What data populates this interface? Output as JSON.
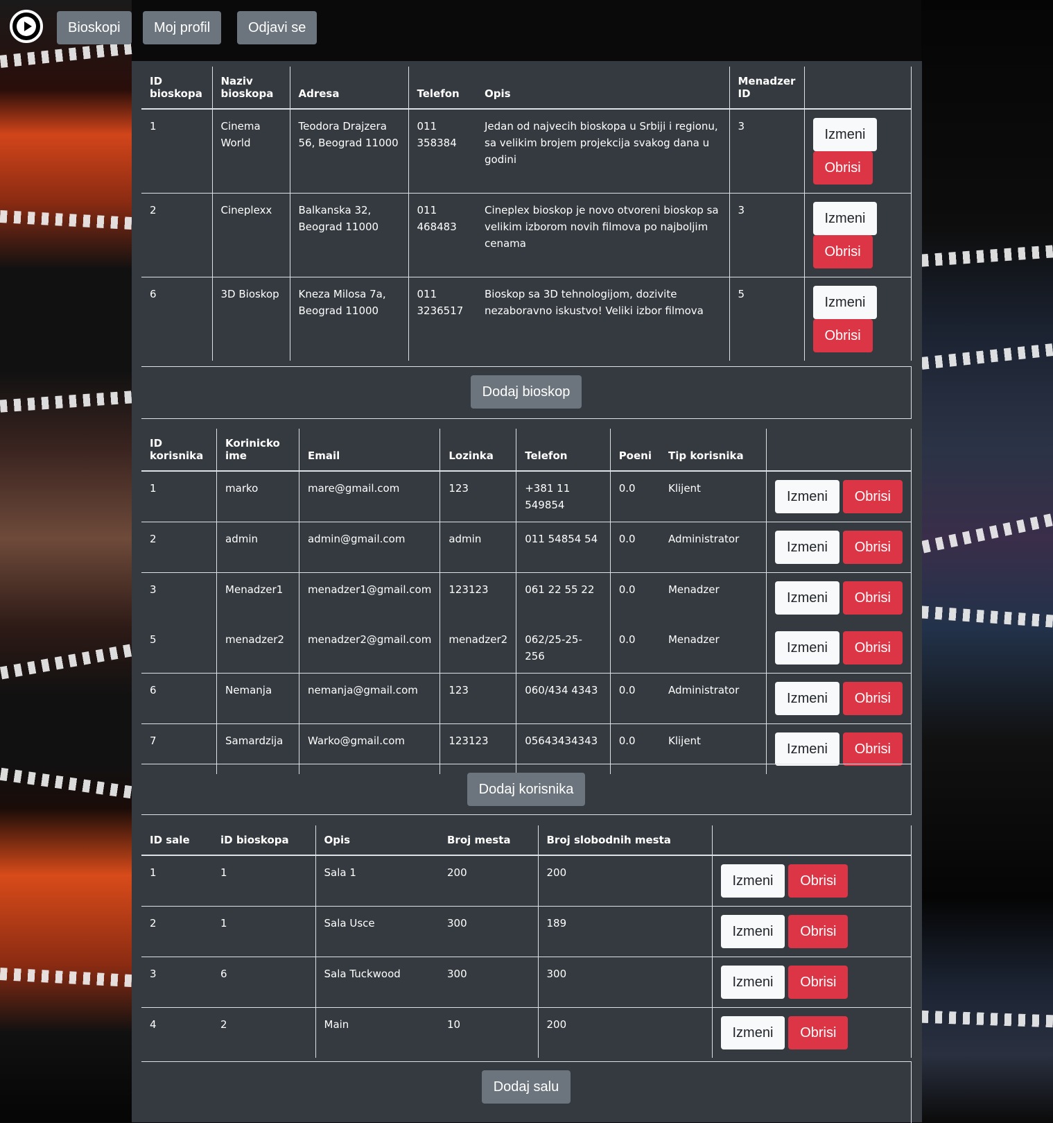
{
  "nav": {
    "items": [
      {
        "label": "Bioskopi"
      },
      {
        "label": "Moj profil"
      },
      {
        "label": "Odjavi se"
      }
    ]
  },
  "cinemas": {
    "headers": [
      "ID bioskopa",
      "Naziv bioskopa",
      "Adresa",
      "Telefon",
      "Opis",
      "Menadzer ID"
    ],
    "rows": [
      {
        "id": "1",
        "name": "Cinema World",
        "address": "Teodora Drajzera 56, Beograd 11000",
        "phone": "011 358384",
        "desc": "Jedan od najvecih bioskopa u Srbiji i regionu, sa velikim brojem projekcija svakog dana u godini",
        "manager": "3"
      },
      {
        "id": "2",
        "name": "Cineplexx",
        "address": "Balkanska 32, Beograd 11000",
        "phone": "011 468483",
        "desc": "Cineplex bioskop je novo otvoreni bioskop sa velikim izborom novih filmova po najboljim cenama",
        "manager": "3"
      },
      {
        "id": "6",
        "name": "3D Bioskop",
        "address": "Kneza Milosa 7a, Beograd 11000",
        "phone": "011 3236517",
        "desc": "Bioskop sa 3D tehnologijom, dozivite nezaboravno iskustvo! Veliki izbor filmova",
        "manager": "5"
      }
    ],
    "add_label": "Dodaj bioskop"
  },
  "users": {
    "headers": [
      "ID korisnika",
      "Korinicko ime",
      "Email",
      "Lozinka",
      "Telefon",
      "Poeni",
      "Tip korisnika"
    ],
    "rows": [
      {
        "id": "1",
        "username": "marko",
        "email": "mare@gmail.com",
        "password": "123",
        "phone": "+381 11 549854",
        "points": "0.0",
        "type": "Klijent"
      },
      {
        "id": "2",
        "username": "admin",
        "email": "admin@gmail.com",
        "password": "admin",
        "phone": "011 54854 54",
        "points": "0.0",
        "type": "Administrator"
      },
      {
        "id": "3",
        "username": "Menadzer1",
        "email": "menadzer1@gmail.com",
        "password": "123123",
        "phone": "061 22 55 22",
        "points": "0.0",
        "type": "Menadzer"
      },
      {
        "id": "5",
        "username": "menadzer2",
        "email": "menadzer2@gmail.com",
        "password": "menadzer2",
        "phone": "062/25-25-256",
        "points": "0.0",
        "type": "Menadzer"
      },
      {
        "id": "6",
        "username": "Nemanja",
        "email": "nemanja@gmail.com",
        "password": "123",
        "phone": "060/434 4343",
        "points": "0.0",
        "type": "Administrator"
      },
      {
        "id": "7",
        "username": "Samardzija",
        "email": "Warko@gmail.com",
        "password": "123123",
        "phone": "05643434343",
        "points": "0.0",
        "type": "Klijent"
      }
    ],
    "add_label": "Dodaj korisnika"
  },
  "halls": {
    "headers": [
      "ID sale",
      "iD bioskopa",
      "Opis",
      "Broj mesta",
      "Broj slobodnih mesta"
    ],
    "rows": [
      {
        "id": "1",
        "cinema_id": "1",
        "desc": "Sala 1",
        "seats": "200",
        "free": "200"
      },
      {
        "id": "2",
        "cinema_id": "1",
        "desc": "Sala Usce",
        "seats": "300",
        "free": "189"
      },
      {
        "id": "3",
        "cinema_id": "6",
        "desc": "Sala Tuckwood",
        "seats": "300",
        "free": "300"
      },
      {
        "id": "4",
        "cinema_id": "2",
        "desc": "Main",
        "seats": "10",
        "free": "200"
      }
    ],
    "add_label": "Dodaj salu"
  },
  "actions": {
    "edit": "Izmeni",
    "delete": "Obrisi"
  },
  "colors": {
    "panel": "#343a40",
    "gray_button": "#6c757d",
    "danger": "#dc3545",
    "light": "#f8f9fa"
  }
}
